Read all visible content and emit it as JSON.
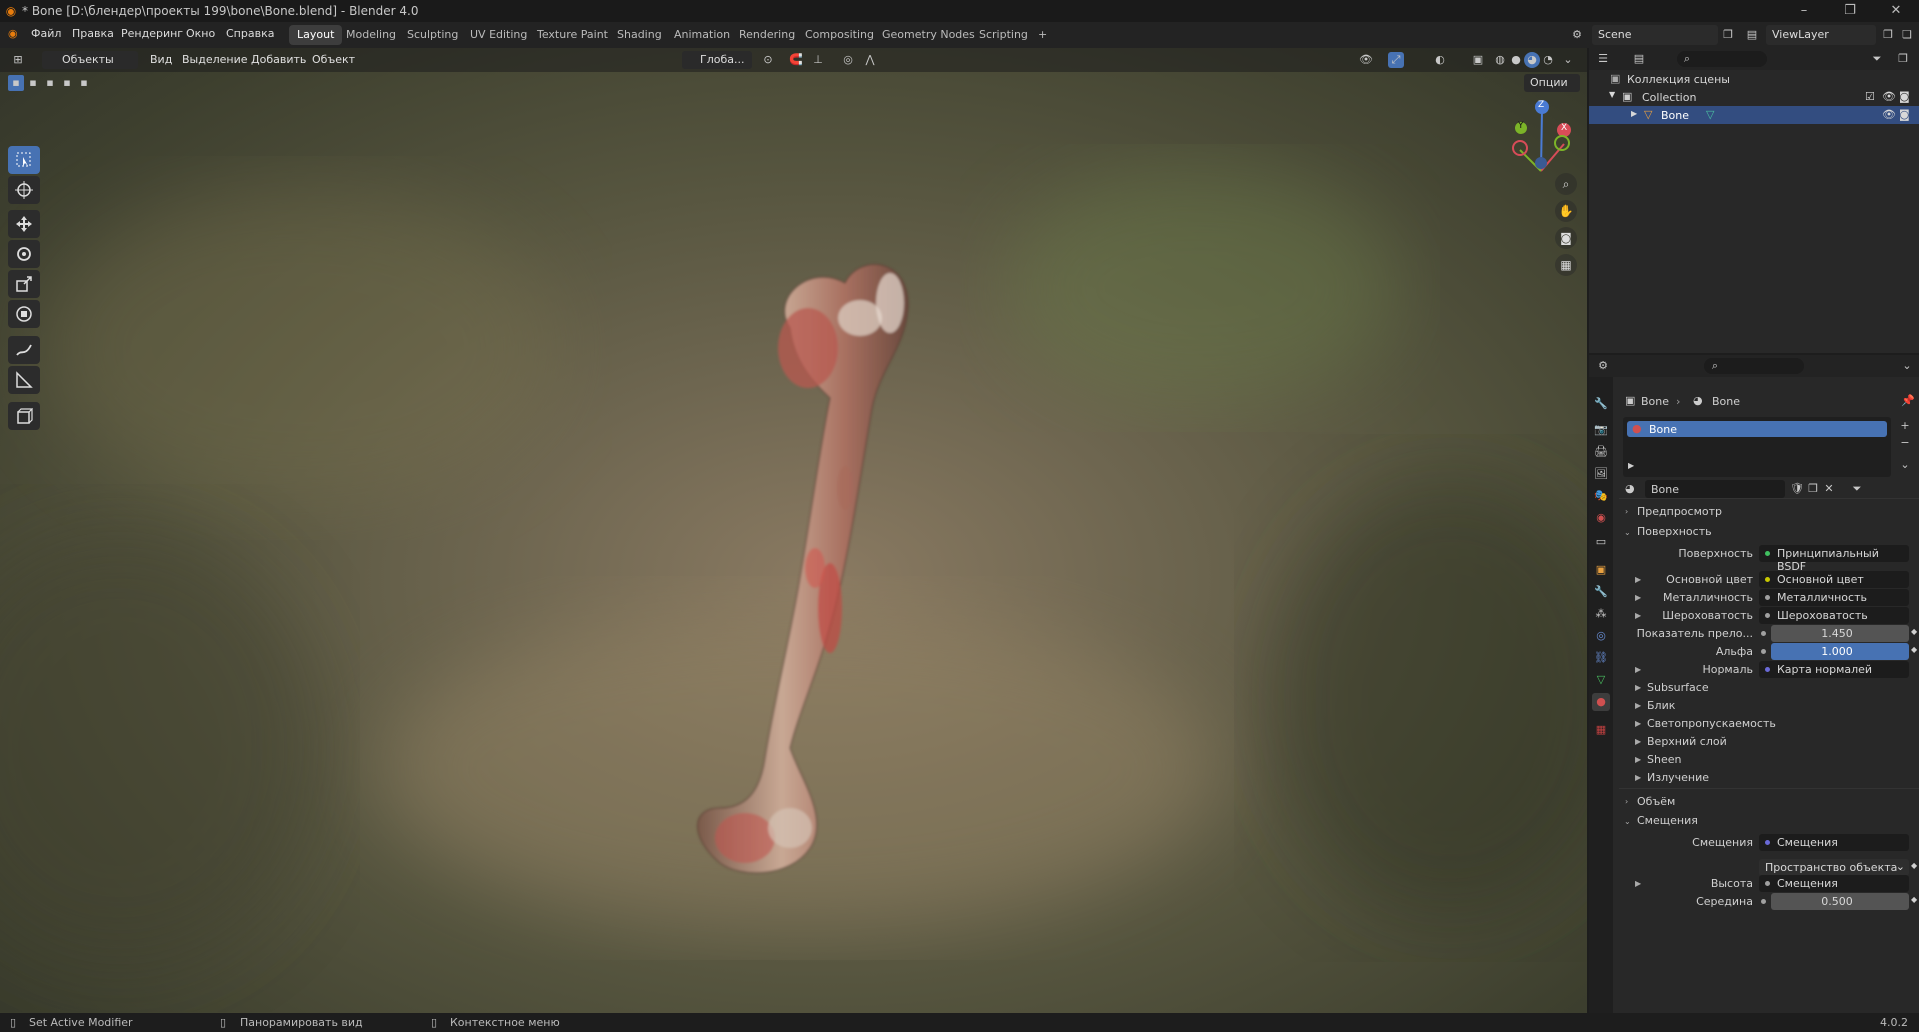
{
  "window": {
    "title": "* Bone [D:\\блендер\\проекты 199\\bone\\Bone.blend] - Blender 4.0",
    "minimize": "–",
    "maximize": "❐",
    "close": "✕"
  },
  "menu": [
    "Файл",
    "Правка",
    "Рендеринг",
    "Окно",
    "Справка"
  ],
  "workspaces": [
    "Layout",
    "Modeling",
    "Sculpting",
    "UV Editing",
    "Texture Paint",
    "Shading",
    "Animation",
    "Rendering",
    "Compositing",
    "Geometry Nodes",
    "Scripting",
    "+"
  ],
  "active_workspace": "Layout",
  "scene": {
    "name": "Scene",
    "view_layer": "ViewLayer"
  },
  "viewport": {
    "mode": "Объекты",
    "menus": [
      "Вид",
      "Выделение",
      "Добавить",
      "Объект"
    ],
    "orientation": "Глоба...",
    "options": "Опции",
    "axes": {
      "x": "X",
      "y": "Y",
      "z": "Z"
    }
  },
  "outliner": {
    "root": "Коллекция сцены",
    "collection": "Collection",
    "object": "Bone"
  },
  "properties": {
    "breadcrumb": [
      "Bone",
      "Bone"
    ],
    "material_slot": "Bone",
    "material_name": "Bone",
    "sections": {
      "preview": "Предпросмотр",
      "surface": "Поверхность",
      "volume": "Объём",
      "displacement": "Смещения"
    },
    "surface_label": "Поверхность",
    "surface_value": "Принципиальный BSDF",
    "rows": [
      {
        "label": "Основной цвет",
        "value": "Основной цвет",
        "dot": "#c8c800"
      },
      {
        "label": "Металличность",
        "value": "Металличность",
        "dot": "#a0a0a0"
      },
      {
        "label": "Шероховатость",
        "value": "Шероховатость",
        "dot": "#a0a0a0"
      }
    ],
    "ior_label": "Показатель прело...",
    "ior_value": "1.450",
    "alpha_label": "Альфа",
    "alpha_value": "1.000",
    "normal_label": "Нормаль",
    "normal_value": "Карта нормалей",
    "subpanels": [
      "Subsurface",
      "Блик",
      "Светопропускаемость",
      "Верхний слой",
      "Sheen",
      "Излучение"
    ],
    "disp_label": "Смещения",
    "disp_value": "Смещения",
    "disp_space": "Пространство объекта",
    "height_label": "Высота",
    "height_value": "Смещения",
    "mid_label": "Середина",
    "mid_value": "0.500"
  },
  "status": {
    "left": "Set Active Modifier",
    "middle": "Панорамировать вид",
    "right": "Контекстное меню",
    "version": "4.0.2"
  }
}
